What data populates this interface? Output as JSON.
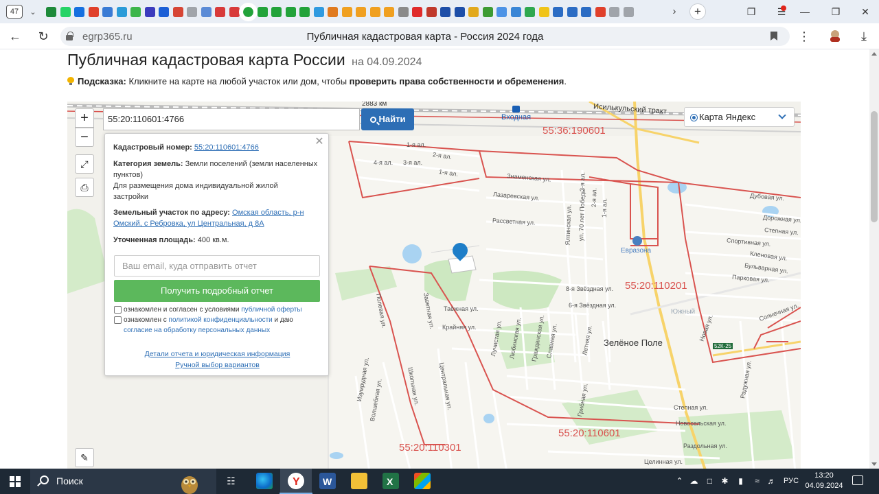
{
  "browser": {
    "tab_count": "47",
    "url_domain": "egrp365.ru",
    "page_title": "Публичная кадастровая карта - Россия 2024 года",
    "favicon_colors": [
      "#1e8a3a",
      "#25d366",
      "#1670e0",
      "#e0402b",
      "#3a7bd5",
      "#2a9bd8",
      "#3cb54a",
      "#3b3bbd",
      "#1b5fd6",
      "#d64535",
      "#a0a4aa",
      "#5b8bd6",
      "#d83a3a",
      "#d83a3a",
      "#22a33a",
      "#22a33a",
      "#22a33a",
      "#22a33a",
      "#22a33a",
      "#2f9ae0",
      "#e07a1f",
      "#f0a020",
      "#f0a020",
      "#f0a020",
      "#f0a020",
      "#8a8a8a",
      "#e02b2b",
      "#c0392b",
      "#1d4ea8",
      "#1d4ea8",
      "#e2a91c",
      "#3d9b33",
      "#4d93e6",
      "#3a86d6",
      "#2fa84f",
      "#f0c419",
      "#2b6cc4",
      "#2b6cc4",
      "#2b6cc4",
      "#e0402b",
      "#a0a4aa",
      "#a0a4aa"
    ]
  },
  "page": {
    "heading": "Публичная кадастровая карта России",
    "heading_date": "на 04.09.2024",
    "hint_label": "Подсказка:",
    "hint_text": " Кликните на карте на любой участок или дом, чтобы ",
    "hint_bold": "проверить права собственности и обременения",
    "hint_end": "."
  },
  "map": {
    "search_value": "55:20:110601:4766",
    "search_button": "Найти",
    "distance": "2883 км",
    "layer_option": "Карта Яндекс",
    "cadastral_labels": [
      "55:36:190601",
      "55:20:110201",
      "55:20:110601",
      "55:20:110301"
    ],
    "places": {
      "station": "Входная",
      "tract": "Исилькульский тракт",
      "district": "Зелёное Поле",
      "hotel": "Евразона",
      "south": "Южный",
      "road_badge": "52К-25"
    },
    "streets": [
      "1-я ал.",
      "2-я ал.",
      "3-я ал.",
      "4-я ал.",
      "1-я ал.",
      "Знаменская ул.",
      "Лазаревская ул.",
      "Рассветная ул.",
      "Ялтинская ул.",
      "ул. 70 лет Победы",
      "3-я ал.",
      "2-я ал.",
      "1-я ал.",
      "Дубовая ул.",
      "Дорожная ул.",
      "Степная ул.",
      "Спортивная ул.",
      "Кленовая ул.",
      "Бульварная ул.",
      "Парковая ул.",
      "8-я Звёздная ул.",
      "6-я Звёздная ул.",
      "Таёжная ул.",
      "Крайняя ул.",
      "Лучистая ул.",
      "Любинская ул.",
      "Гражданская ул.",
      "Славная ул.",
      "Летняя ул.",
      "Новая ул.",
      "Солнечная ул.",
      "Радужная ул.",
      "Полевая ул.",
      "Заветная ул.",
      "Изумрудная ул.",
      "Волшебная ул.",
      "Школьная ул.",
      "Центральная ул.",
      "Грибная ул.",
      "Степная ул.",
      "Новосельская ул.",
      "Раздольная ул.",
      "Целинная ул."
    ]
  },
  "popup": {
    "cad_label": "Кадастровый номер:",
    "cad_value": "55:20:110601:4766",
    "category_label": "Категория земель:",
    "category_value": "Земли поселений (земли населенных пунктов)",
    "usage": "Для размещения дома индивидуальной жилой застройки",
    "address_label": "Земельный участок по адресу:",
    "address_value": "Омская область, р-н Омский, с Ребровка, ул Центральная, д 8А",
    "area_label": "Уточненная площадь:",
    "area_value": "400 кв.м.",
    "email_placeholder": "Ваш email, куда отправить отчет",
    "report_button": "Получить подробный отчет",
    "consent1_text": "ознакомлен и согласен с условиями ",
    "consent1_link": "публичной оферты",
    "consent2_text": "ознакомлен с ",
    "consent2_link": "политикой конфиденциальности",
    "consent2_mid": " и даю",
    "consent2_link2": "согласие на обработку персональных данных",
    "details_link": "Детали отчета и юридическая информация",
    "manual_link": "Ручной выбор вариантов"
  },
  "taskbar": {
    "search_text": "Поиск",
    "language": "РУС",
    "time": "13:20",
    "date": "04.09.2024"
  }
}
